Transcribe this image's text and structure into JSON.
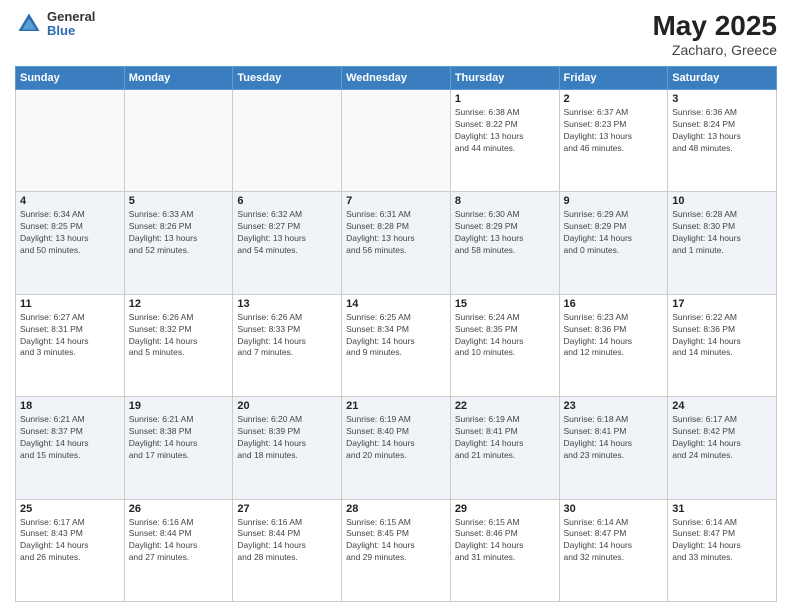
{
  "header": {
    "logo_general": "General",
    "logo_blue": "Blue",
    "title": "May 2025",
    "subtitle": "Zacharo, Greece"
  },
  "days_of_week": [
    "Sunday",
    "Monday",
    "Tuesday",
    "Wednesday",
    "Thursday",
    "Friday",
    "Saturday"
  ],
  "weeks": [
    {
      "alt": false,
      "days": [
        {
          "num": "",
          "info": ""
        },
        {
          "num": "",
          "info": ""
        },
        {
          "num": "",
          "info": ""
        },
        {
          "num": "",
          "info": ""
        },
        {
          "num": "1",
          "info": "Sunrise: 6:38 AM\nSunset: 8:22 PM\nDaylight: 13 hours\nand 44 minutes."
        },
        {
          "num": "2",
          "info": "Sunrise: 6:37 AM\nSunset: 8:23 PM\nDaylight: 13 hours\nand 46 minutes."
        },
        {
          "num": "3",
          "info": "Sunrise: 6:36 AM\nSunset: 8:24 PM\nDaylight: 13 hours\nand 48 minutes."
        }
      ]
    },
    {
      "alt": true,
      "days": [
        {
          "num": "4",
          "info": "Sunrise: 6:34 AM\nSunset: 8:25 PM\nDaylight: 13 hours\nand 50 minutes."
        },
        {
          "num": "5",
          "info": "Sunrise: 6:33 AM\nSunset: 8:26 PM\nDaylight: 13 hours\nand 52 minutes."
        },
        {
          "num": "6",
          "info": "Sunrise: 6:32 AM\nSunset: 8:27 PM\nDaylight: 13 hours\nand 54 minutes."
        },
        {
          "num": "7",
          "info": "Sunrise: 6:31 AM\nSunset: 8:28 PM\nDaylight: 13 hours\nand 56 minutes."
        },
        {
          "num": "8",
          "info": "Sunrise: 6:30 AM\nSunset: 8:29 PM\nDaylight: 13 hours\nand 58 minutes."
        },
        {
          "num": "9",
          "info": "Sunrise: 6:29 AM\nSunset: 8:29 PM\nDaylight: 14 hours\nand 0 minutes."
        },
        {
          "num": "10",
          "info": "Sunrise: 6:28 AM\nSunset: 8:30 PM\nDaylight: 14 hours\nand 1 minute."
        }
      ]
    },
    {
      "alt": false,
      "days": [
        {
          "num": "11",
          "info": "Sunrise: 6:27 AM\nSunset: 8:31 PM\nDaylight: 14 hours\nand 3 minutes."
        },
        {
          "num": "12",
          "info": "Sunrise: 6:26 AM\nSunset: 8:32 PM\nDaylight: 14 hours\nand 5 minutes."
        },
        {
          "num": "13",
          "info": "Sunrise: 6:26 AM\nSunset: 8:33 PM\nDaylight: 14 hours\nand 7 minutes."
        },
        {
          "num": "14",
          "info": "Sunrise: 6:25 AM\nSunset: 8:34 PM\nDaylight: 14 hours\nand 9 minutes."
        },
        {
          "num": "15",
          "info": "Sunrise: 6:24 AM\nSunset: 8:35 PM\nDaylight: 14 hours\nand 10 minutes."
        },
        {
          "num": "16",
          "info": "Sunrise: 6:23 AM\nSunset: 8:36 PM\nDaylight: 14 hours\nand 12 minutes."
        },
        {
          "num": "17",
          "info": "Sunrise: 6:22 AM\nSunset: 8:36 PM\nDaylight: 14 hours\nand 14 minutes."
        }
      ]
    },
    {
      "alt": true,
      "days": [
        {
          "num": "18",
          "info": "Sunrise: 6:21 AM\nSunset: 8:37 PM\nDaylight: 14 hours\nand 15 minutes."
        },
        {
          "num": "19",
          "info": "Sunrise: 6:21 AM\nSunset: 8:38 PM\nDaylight: 14 hours\nand 17 minutes."
        },
        {
          "num": "20",
          "info": "Sunrise: 6:20 AM\nSunset: 8:39 PM\nDaylight: 14 hours\nand 18 minutes."
        },
        {
          "num": "21",
          "info": "Sunrise: 6:19 AM\nSunset: 8:40 PM\nDaylight: 14 hours\nand 20 minutes."
        },
        {
          "num": "22",
          "info": "Sunrise: 6:19 AM\nSunset: 8:41 PM\nDaylight: 14 hours\nand 21 minutes."
        },
        {
          "num": "23",
          "info": "Sunrise: 6:18 AM\nSunset: 8:41 PM\nDaylight: 14 hours\nand 23 minutes."
        },
        {
          "num": "24",
          "info": "Sunrise: 6:17 AM\nSunset: 8:42 PM\nDaylight: 14 hours\nand 24 minutes."
        }
      ]
    },
    {
      "alt": false,
      "days": [
        {
          "num": "25",
          "info": "Sunrise: 6:17 AM\nSunset: 8:43 PM\nDaylight: 14 hours\nand 26 minutes."
        },
        {
          "num": "26",
          "info": "Sunrise: 6:16 AM\nSunset: 8:44 PM\nDaylight: 14 hours\nand 27 minutes."
        },
        {
          "num": "27",
          "info": "Sunrise: 6:16 AM\nSunset: 8:44 PM\nDaylight: 14 hours\nand 28 minutes."
        },
        {
          "num": "28",
          "info": "Sunrise: 6:15 AM\nSunset: 8:45 PM\nDaylight: 14 hours\nand 29 minutes."
        },
        {
          "num": "29",
          "info": "Sunrise: 6:15 AM\nSunset: 8:46 PM\nDaylight: 14 hours\nand 31 minutes."
        },
        {
          "num": "30",
          "info": "Sunrise: 6:14 AM\nSunset: 8:47 PM\nDaylight: 14 hours\nand 32 minutes."
        },
        {
          "num": "31",
          "info": "Sunrise: 6:14 AM\nSunset: 8:47 PM\nDaylight: 14 hours\nand 33 minutes."
        }
      ]
    }
  ]
}
